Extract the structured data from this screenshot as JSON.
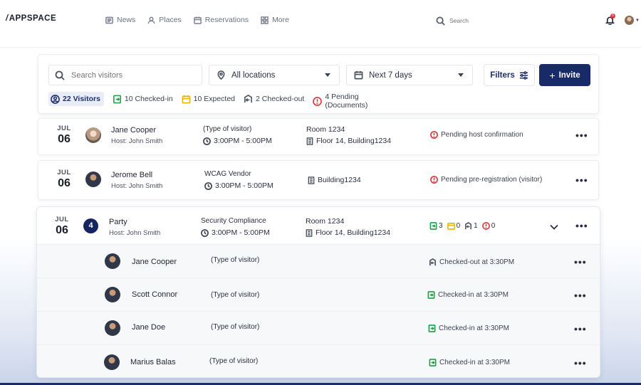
{
  "brand": "APPSPACE",
  "nav": [
    {
      "label": "News",
      "icon": "news-icon"
    },
    {
      "label": "Places",
      "icon": "places-icon"
    },
    {
      "label": "Reservations",
      "icon": "calendar-icon"
    },
    {
      "label": "More",
      "icon": "grid-icon"
    }
  ],
  "search_top": {
    "placeholder": "Search"
  },
  "notifications": {
    "count": "6"
  },
  "filters": {
    "search_placeholder": "Search visitors",
    "location": "All locations",
    "date_range": "Next 7 days",
    "filters_label": "Filters",
    "invite_label": "Invite",
    "invite_plus": "+"
  },
  "stats": {
    "visitors": "22 Visitors",
    "checked_in": "10 Checked-in",
    "expected": "10 Expected",
    "checked_out": "2 Checked-out",
    "pending_1": "4 Pending",
    "pending_2": "(Documents)"
  },
  "colors": {
    "accent": "#182a68",
    "checked_in": "#1e9e4a",
    "expected": "#e9b300",
    "pending": "#d9363e"
  },
  "rows": [
    {
      "month": "JUL",
      "day": "06",
      "name": "Jane Cooper",
      "host": "Host: John Smith",
      "type": "(Type of visitor)",
      "time": "3:00PM - 5:00PM",
      "room": "Room 1234",
      "floor": "Floor 14, Building1234",
      "status": "Pending host confirmation"
    },
    {
      "month": "JUL",
      "day": "06",
      "name": "Jerome Bell",
      "host": "Host: John Smith",
      "type": "WCAG Vendor",
      "time": "3:00PM - 5:00PM",
      "floor": "Building1234",
      "status": "Pending pre-registration (visitor)"
    }
  ],
  "group": {
    "month": "JUL",
    "day": "06",
    "count": "4",
    "name": "Party",
    "host": "Host: John Smith",
    "type": "Security Compliance",
    "time": "3:00PM - 5:00PM",
    "room": "Room 1234",
    "floor": "Floor 14, Building1234",
    "checked_in": "3",
    "expected": "0",
    "checked_out": "1",
    "pending": "0",
    "members": [
      {
        "name": "Jane Cooper",
        "type": "(Type of visitor)",
        "status": "Checked-out at 3:30PM",
        "kind": "out"
      },
      {
        "name": "Scott Connor",
        "type": "(Type of visitor)",
        "status": "Checked-in at 3:30PM",
        "kind": "in"
      },
      {
        "name": "Jane Doe",
        "type": "(Type of visitor)",
        "status": "Checked-in at 3:30PM",
        "kind": "in"
      },
      {
        "name": "Marius Balas",
        "type": "(Type of visitor)",
        "status": "Checked-in at 3:30PM",
        "kind": "in"
      }
    ]
  }
}
